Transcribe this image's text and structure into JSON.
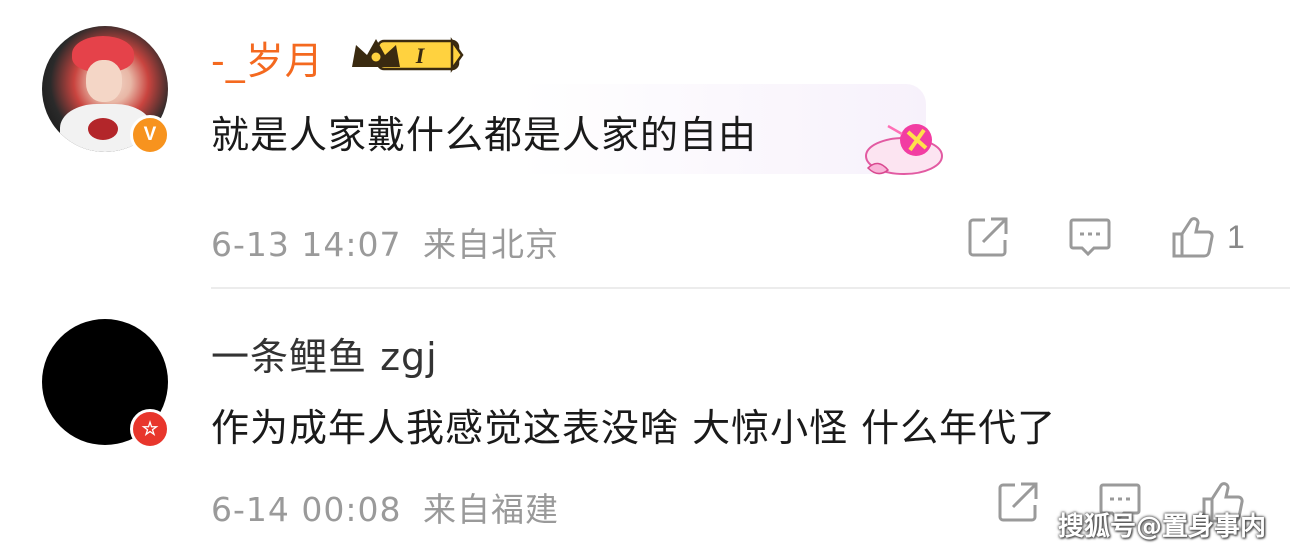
{
  "comments": [
    {
      "username": "-_岁月",
      "level_tag": "I",
      "text": "就是人家戴什么都是人家的自由",
      "timestamp": "6-13 14:07",
      "location": "来自北京",
      "like_count": "1",
      "verify_badge": "V",
      "colors": {
        "username": "#f4691f",
        "badge": "#f7931e"
      }
    },
    {
      "username": "一条鲤鱼 zgj",
      "text": "作为成年人我感觉这表没啥 大惊小怪 什么年代了",
      "timestamp": "6-14 00:08",
      "location": "来自福建",
      "verify_badge": "☆",
      "colors": {
        "username": "#333333",
        "badge": "#e8362c"
      }
    }
  ],
  "icons": [
    "share-icon",
    "comment-icon",
    "like-icon",
    "crown-icon",
    "sticker-icon"
  ],
  "watermark": "搜狐号@置身事内"
}
